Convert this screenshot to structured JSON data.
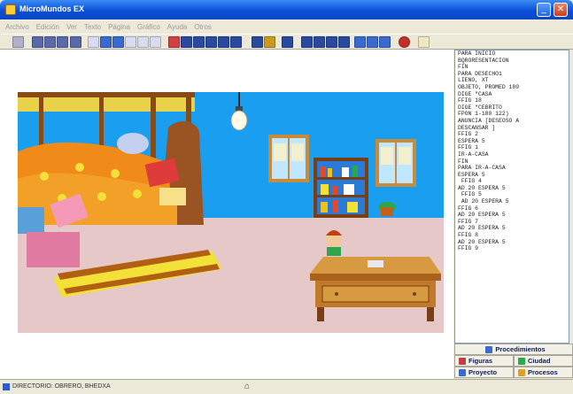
{
  "window": {
    "title": "MicroMundos EX",
    "minimize": "_",
    "close": "✕"
  },
  "menu": [
    "Archivo",
    "Edición",
    "Ver",
    "Texto",
    "Página",
    "Gráfico",
    "Ayuda",
    "Otros"
  ],
  "colors": {
    "wall": "#1a9ef0",
    "floor": "#e7c8c8",
    "title_blue": "#0a4fd8"
  },
  "code": {
    "lines": [
      "PARA INICIO",
      "BQRORESENTACION",
      "FIN",
      "",
      "PARA DESECHO1",
      "LIENO, XT",
      "OBJETO, PROMED 180",
      "DIGE \"CASA",
      "FFIG 18",
      "DIGE \"CEBRITO",
      "FPON 1-180 122)",
      "ANUNCIA [DESEOSO A",
      "DESCANSAR ]",
      "FFIG 2",
      "ESPERA 5",
      "FFIG 1",
      "IR-A-CASA",
      "FIN",
      "",
      "PARA IR-A-CASA",
      "ESPERA 5",
      " FFIG 4",
      "AD 20 ESPERA 5",
      " FFIG 5",
      " AD 20 ESPERA 5",
      "FFIG 6",
      "AD 20 ESPERA 5",
      "FFIG 7",
      "AD 20 ESPERA 5",
      "FFIG 8",
      "AD 20 ESPERA 5",
      "FFIG 9"
    ]
  },
  "tabs": {
    "procedimientos": "Procedimientos",
    "figuras": "Figuras",
    "ciudad": "Ciudad",
    "proyecto": "Proyecto",
    "procesos": "Procesos"
  },
  "status": {
    "text": "DIRECTORIO: OBRERO, BHEDXA",
    "center_icon": "home-icon"
  }
}
